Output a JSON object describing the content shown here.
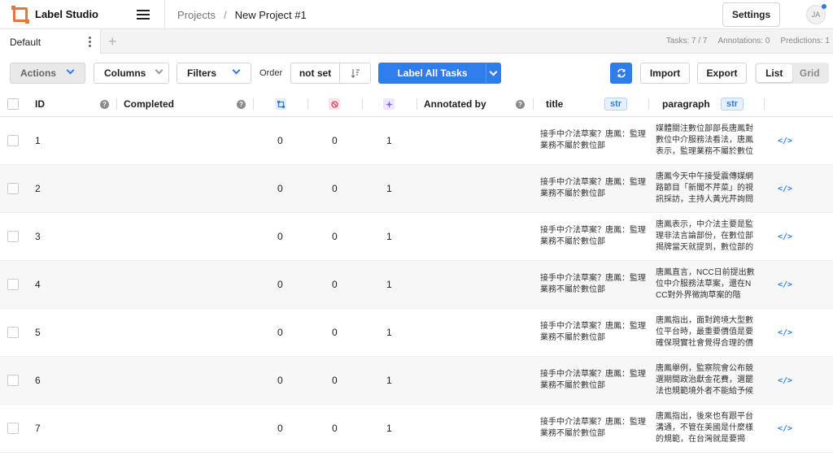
{
  "app": {
    "name": "Label Studio"
  },
  "breadcrumb": {
    "projects": "Projects",
    "separator": "/",
    "current": "New Project #1"
  },
  "header": {
    "settings_label": "Settings",
    "avatar_initials": "JA"
  },
  "tabs": {
    "active": "Default",
    "add": "+"
  },
  "stats": {
    "tasks": "Tasks: 7 / 7",
    "annotations": "Annotations: 0",
    "predictions": "Predictions: 1"
  },
  "toolbar": {
    "actions": "Actions",
    "columns": "Columns",
    "filters": "Filters",
    "order_label": "Order",
    "order_value": "not set",
    "label_all": "Label All Tasks",
    "import": "Import",
    "export": "Export",
    "view_list": "List",
    "view_grid": "Grid"
  },
  "columns": {
    "id": "ID",
    "completed": "Completed",
    "annotated_by": "Annotated by",
    "title": "title",
    "paragraph": "paragraph",
    "type_badge": "str",
    "help": "?"
  },
  "colors": {
    "accent": "#2f7ded",
    "logo": "#e4773b",
    "cancel": "#e0475a",
    "prediction": "#8f5cf7"
  },
  "rows": [
    {
      "id": "1",
      "total_annotations": "0",
      "cancelled": "0",
      "predictions": "1",
      "title": "接手中介法草案？唐鳳：監理業務不屬於數位部",
      "paragraph": "媒體關注數位部部長唐鳳對數位中介服務法看法，唐鳳表示，監理業務不屬於數位"
    },
    {
      "id": "2",
      "total_annotations": "0",
      "cancelled": "0",
      "predictions": "1",
      "title": "接手中介法草案？唐鳳：監理業務不屬於數位部",
      "paragraph": "唐鳳今天中午接受震傳媒網路節目「新聞不芹菜」的視訊採訪，主持人黃光芹詢問"
    },
    {
      "id": "3",
      "total_annotations": "0",
      "cancelled": "0",
      "predictions": "1",
      "title": "接手中介法草案？唐鳳：監理業務不屬於數位部",
      "paragraph": "唐鳳表示，中介法主要是監理非法言論部份，在數位部揭牌當天就提到，數位部的"
    },
    {
      "id": "4",
      "total_annotations": "0",
      "cancelled": "0",
      "predictions": "1",
      "title": "接手中介法草案？唐鳳：監理業務不屬於數位部",
      "paragraph": "唐鳳直言，NCC日前提出數位中介服務法草案，還在NCC對外界徵詢草案的階"
    },
    {
      "id": "5",
      "total_annotations": "0",
      "cancelled": "0",
      "predictions": "1",
      "title": "接手中介法草案？唐鳳：監理業務不屬於數位部",
      "paragraph": "唐鳳指出，面對跨境大型數位平台時，最重要價值是要確保現實社會覺得合理的價"
    },
    {
      "id": "6",
      "total_annotations": "0",
      "cancelled": "0",
      "predictions": "1",
      "title": "接手中介法草案？唐鳳：監理業務不屬於數位部",
      "paragraph": "唐鳳舉例，監察院會公布競選期間政治獻金花費，選罷法也規範境外者不能給予候"
    },
    {
      "id": "7",
      "total_annotations": "0",
      "cancelled": "0",
      "predictions": "1",
      "title": "接手中介法草案？唐鳳：監理業務不屬於數位部",
      "paragraph": "唐鳳指出，後來也有跟平台溝通，不管在美國是什麼樣的規範，在台灣就是要揭"
    }
  ]
}
